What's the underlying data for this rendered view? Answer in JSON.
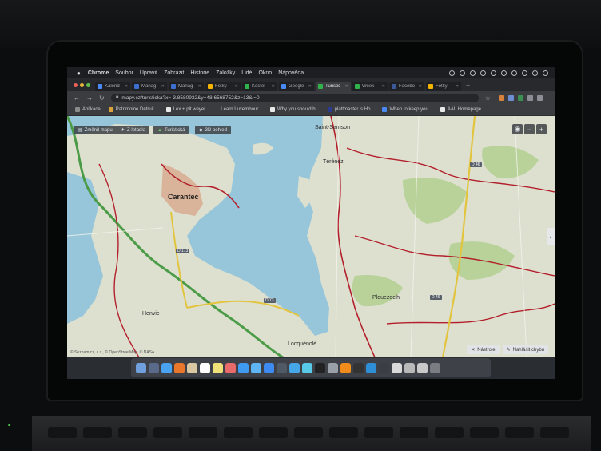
{
  "menubar": {
    "app": "Chrome",
    "items": [
      "Soubor",
      "Upravit",
      "Zobrazit",
      "Historie",
      "Záložky",
      "Lidé",
      "Okno",
      "Nápověda"
    ]
  },
  "tabs": [
    {
      "label": "Kalend",
      "color": "#4a8af4"
    },
    {
      "label": "Manag",
      "color": "#3d6fd1"
    },
    {
      "label": "Manag",
      "color": "#3d6fd1"
    },
    {
      "label": "Fotky",
      "color": "#f4b400"
    },
    {
      "label": "Kostel",
      "color": "#2fb34a"
    },
    {
      "label": "Google",
      "color": "#4a8af4"
    },
    {
      "label": "Turistic",
      "color": "#2fb34a",
      "active": true
    },
    {
      "label": "Week",
      "color": "#2fb34a"
    },
    {
      "label": "Facebo",
      "color": "#3b5998"
    },
    {
      "label": "Fotky",
      "color": "#f4b400"
    }
  ],
  "toolbar": {
    "url": "mapy.cz/turisticka?x=-3.8580932&y=48.6568752&z=13&l=0"
  },
  "bookmarks": [
    {
      "label": "Aplikace",
      "color": "#8a8a8a"
    },
    {
      "label": "Patrimoine Détruit...",
      "color": "#d9a23b"
    },
    {
      "label": "Lex + pit weyer",
      "color": "#e9e9e9"
    },
    {
      "label": "Learn Luxembour...",
      "color": "#3a3c40"
    },
    {
      "label": "Why you should b...",
      "color": "#e9e9e9"
    },
    {
      "label": "plattmaster 's Ho...",
      "color": "#2b3b8f"
    },
    {
      "label": "When to keep you...",
      "color": "#4a8af4"
    },
    {
      "label": "AAL Homepage",
      "color": "#e9e9e9"
    }
  ],
  "map_controls": {
    "change_map": "Změnit mapu",
    "aerial": "Z letadla",
    "tourist": "Turistická",
    "view3d": "3D pohled",
    "zoom_out": "−",
    "zoom_in": "+",
    "tools": "Nástroje",
    "report": "Nahlásit chybu",
    "copyright": "© Seznam.cz, a.s., © OpenStreetMap, © NASA"
  },
  "places": {
    "carantec": "Carantec",
    "henvic": "Henvic",
    "locquenole": "Locquénolé",
    "plouezoch": "Plouezoc'h",
    "saint_samson": "Saint-Samson",
    "terenez": "Térénez",
    "road1": "D 173",
    "road2": "D 73",
    "road3": "D 46",
    "road4": "D 46"
  },
  "colors": {
    "sea": "#97c6da",
    "land": "#dde0cf",
    "forest": "#b8d29a",
    "trail_red": "#b3202c",
    "road_yellow": "#e3c43e",
    "road_green": "#4b9b47"
  }
}
